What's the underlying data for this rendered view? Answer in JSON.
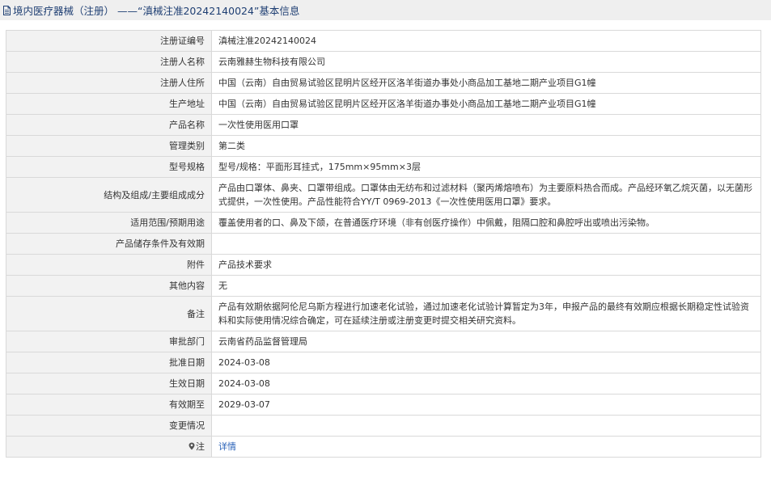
{
  "header": {
    "title": "境内医疗器械（注册） ——“滇械注准20242140024”基本信息",
    "icon": "document-icon"
  },
  "rows": [
    {
      "label": "注册证编号",
      "value": "滇械注准20242140024"
    },
    {
      "label": "注册人名称",
      "value": "云南雅赫生物科技有限公司"
    },
    {
      "label": "注册人住所",
      "value": "中国（云南）自由贸易试验区昆明片区经开区洛羊街道办事处小商品加工基地二期产业项目G1幢"
    },
    {
      "label": "生产地址",
      "value": "中国（云南）自由贸易试验区昆明片区经开区洛羊街道办事处小商品加工基地二期产业项目G1幢"
    },
    {
      "label": "产品名称",
      "value": "一次性使用医用口罩"
    },
    {
      "label": "管理类别",
      "value": "第二类"
    },
    {
      "label": "型号规格",
      "value": "型号/规格：平面形耳挂式，175mm×95mm×3层"
    },
    {
      "label": "结构及组成/主要组成成分",
      "value": "产品由口罩体、鼻夹、口罩带组成。口罩体由无纺布和过滤材料（聚丙烯熔喷布）为主要原料热合而成。产品经环氧乙烷灭菌，以无菌形式提供，一次性使用。产品性能符合YY/T 0969-2013《一次性使用医用口罩》要求。"
    },
    {
      "label": "适用范围/预期用途",
      "value": "覆盖使用者的口、鼻及下颌，在普通医疗环境（非有创医疗操作）中佩戴，阻隔口腔和鼻腔呼出或喷出污染物。"
    },
    {
      "label": "产品储存条件及有效期",
      "value": ""
    },
    {
      "label": "附件",
      "value": "产品技术要求"
    },
    {
      "label": "其他内容",
      "value": "无"
    },
    {
      "label": "备注",
      "value": "产品有效期依据阿伦尼乌斯方程进行加速老化试验，通过加速老化试验计算暂定为3年，申报产品的最终有效期应根据长期稳定性试验资料和实际使用情况综合确定，可在延续注册或注册变更时提交相关研究资料。"
    },
    {
      "label": "审批部门",
      "value": "云南省药品监督管理局"
    },
    {
      "label": "批准日期",
      "value": "2024-03-08"
    },
    {
      "label": "生效日期",
      "value": "2024-03-08"
    },
    {
      "label": "有效期至",
      "value": "2029-03-07"
    },
    {
      "label": "变更情况",
      "value": ""
    }
  ],
  "note": {
    "label": "注",
    "icon": "location-pin-icon",
    "link_text": "详情"
  },
  "colors": {
    "title_text": "#1f3f73",
    "title_bg": "#efefef",
    "label_bg": "#f2f2f2",
    "border": "#d9d9d9",
    "link": "#2a62b8"
  }
}
